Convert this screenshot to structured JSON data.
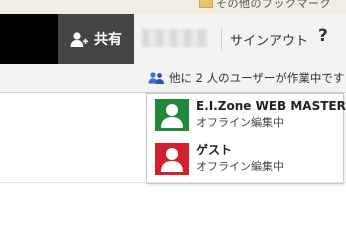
{
  "top_strip": {
    "cut_text": "その他のブックマーク"
  },
  "header": {
    "share_label": "共有",
    "signout_label": "サインアウト",
    "help_label": "?"
  },
  "editing": {
    "label": "他に 2 人のユーザーが作業中です"
  },
  "users": [
    {
      "name": "E.I.Zone WEB MASTER",
      "status": "オフライン編集中",
      "color": "#21883a"
    },
    {
      "name": "ゲスト",
      "status": "オフライン編集中",
      "color": "#d2202e"
    }
  ],
  "icons": {
    "share": "add-person-icon",
    "editing": "people-icon",
    "caret": "caret-down-icon",
    "avatar": "person-silhouette-icon"
  }
}
